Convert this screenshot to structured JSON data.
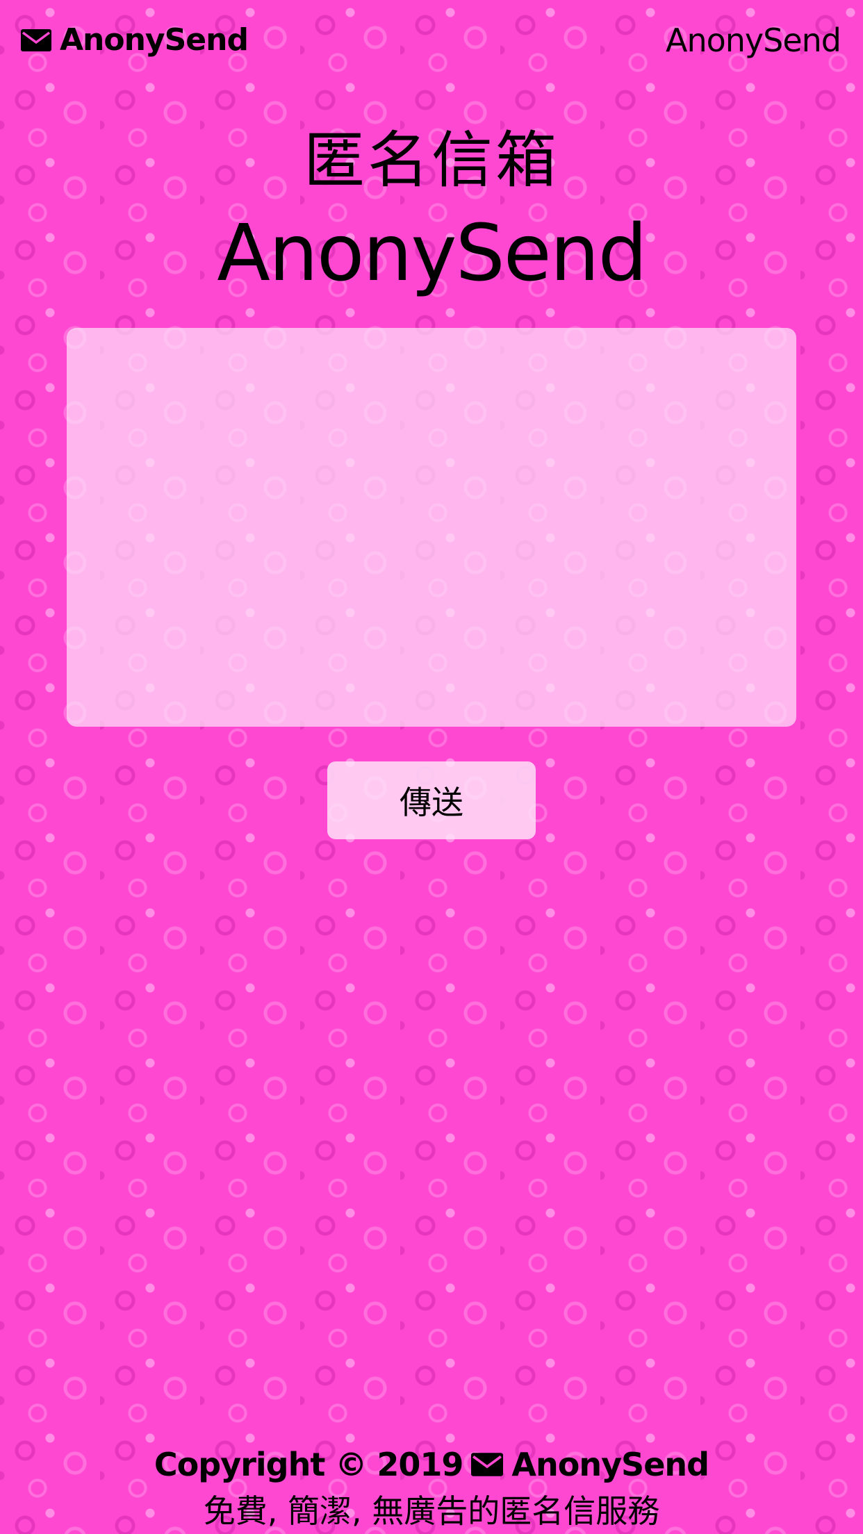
{
  "header": {
    "brand_label": "AnonySend",
    "nav_link_label": "AnonySend",
    "brand_icon": "envelope-icon"
  },
  "hero": {
    "subtitle": "匿名信箱",
    "title": "AnonySend"
  },
  "form": {
    "message_value": "",
    "message_placeholder": "",
    "send_label": "傳送"
  },
  "footer": {
    "copyright_prefix": "Copyright © 2019",
    "copyright_brand": "AnonySend",
    "tagline": "免費, 簡潔, 無廣告的匿名信服務"
  },
  "colors": {
    "background": "#ff48d2",
    "panel": "#ffe1f8",
    "text": "#000000"
  }
}
